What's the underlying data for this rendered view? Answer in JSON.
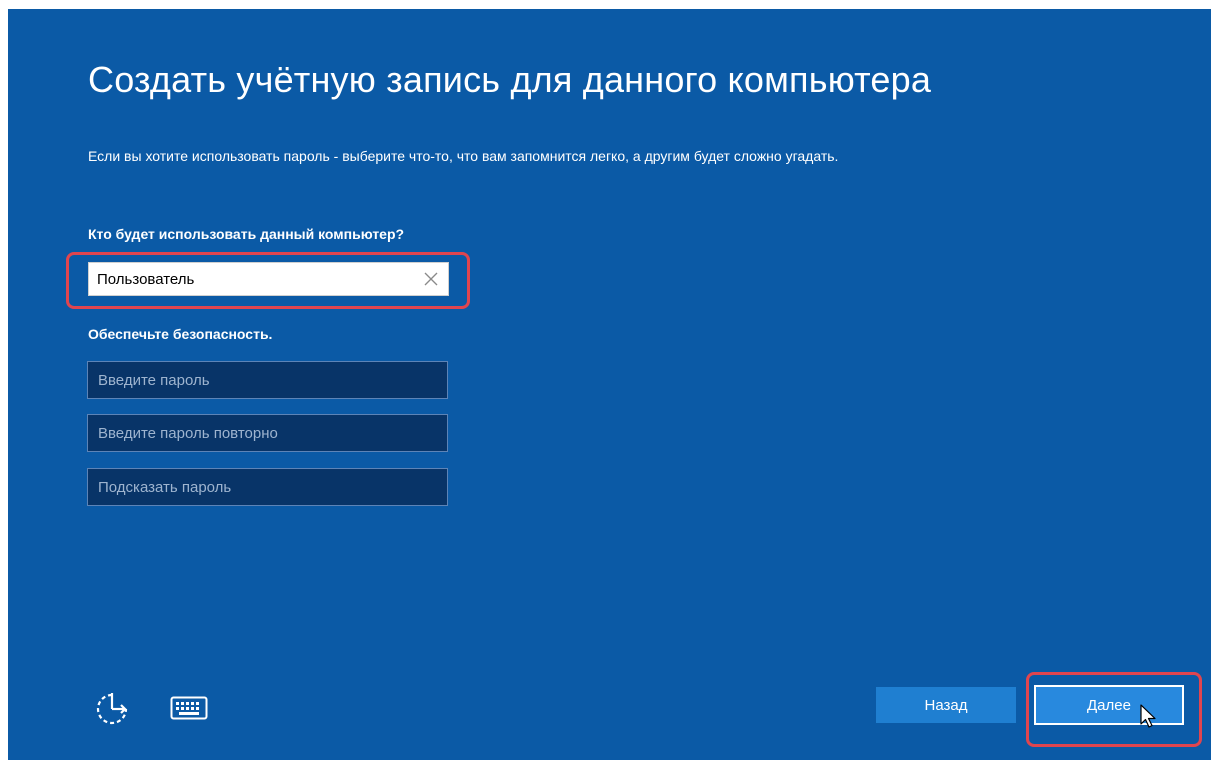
{
  "page": {
    "title": "Создать учётную запись для данного компьютера",
    "description": "Если вы хотите использовать пароль - выберите что-то, что вам запомнится легко, а другим будет сложно угадать."
  },
  "user_section": {
    "label": "Кто будет использовать данный компьютер?",
    "username_value": "Пользователь",
    "clear_icon": "close-icon"
  },
  "security_section": {
    "label": "Обеспечьте безопасность.",
    "password_placeholder": "Введите пароль",
    "confirm_placeholder": "Введите пароль повторно",
    "hint_placeholder": "Подсказать пароль"
  },
  "footer": {
    "accessibility_icon": "ease-of-access-icon",
    "keyboard_icon": "keyboard-icon",
    "back_label": "Назад",
    "next_label": "Далее"
  },
  "colors": {
    "background": "#0b5aa6",
    "highlight": "#e0454f",
    "input_dark": "#083468",
    "button": "#1f7fd1"
  }
}
